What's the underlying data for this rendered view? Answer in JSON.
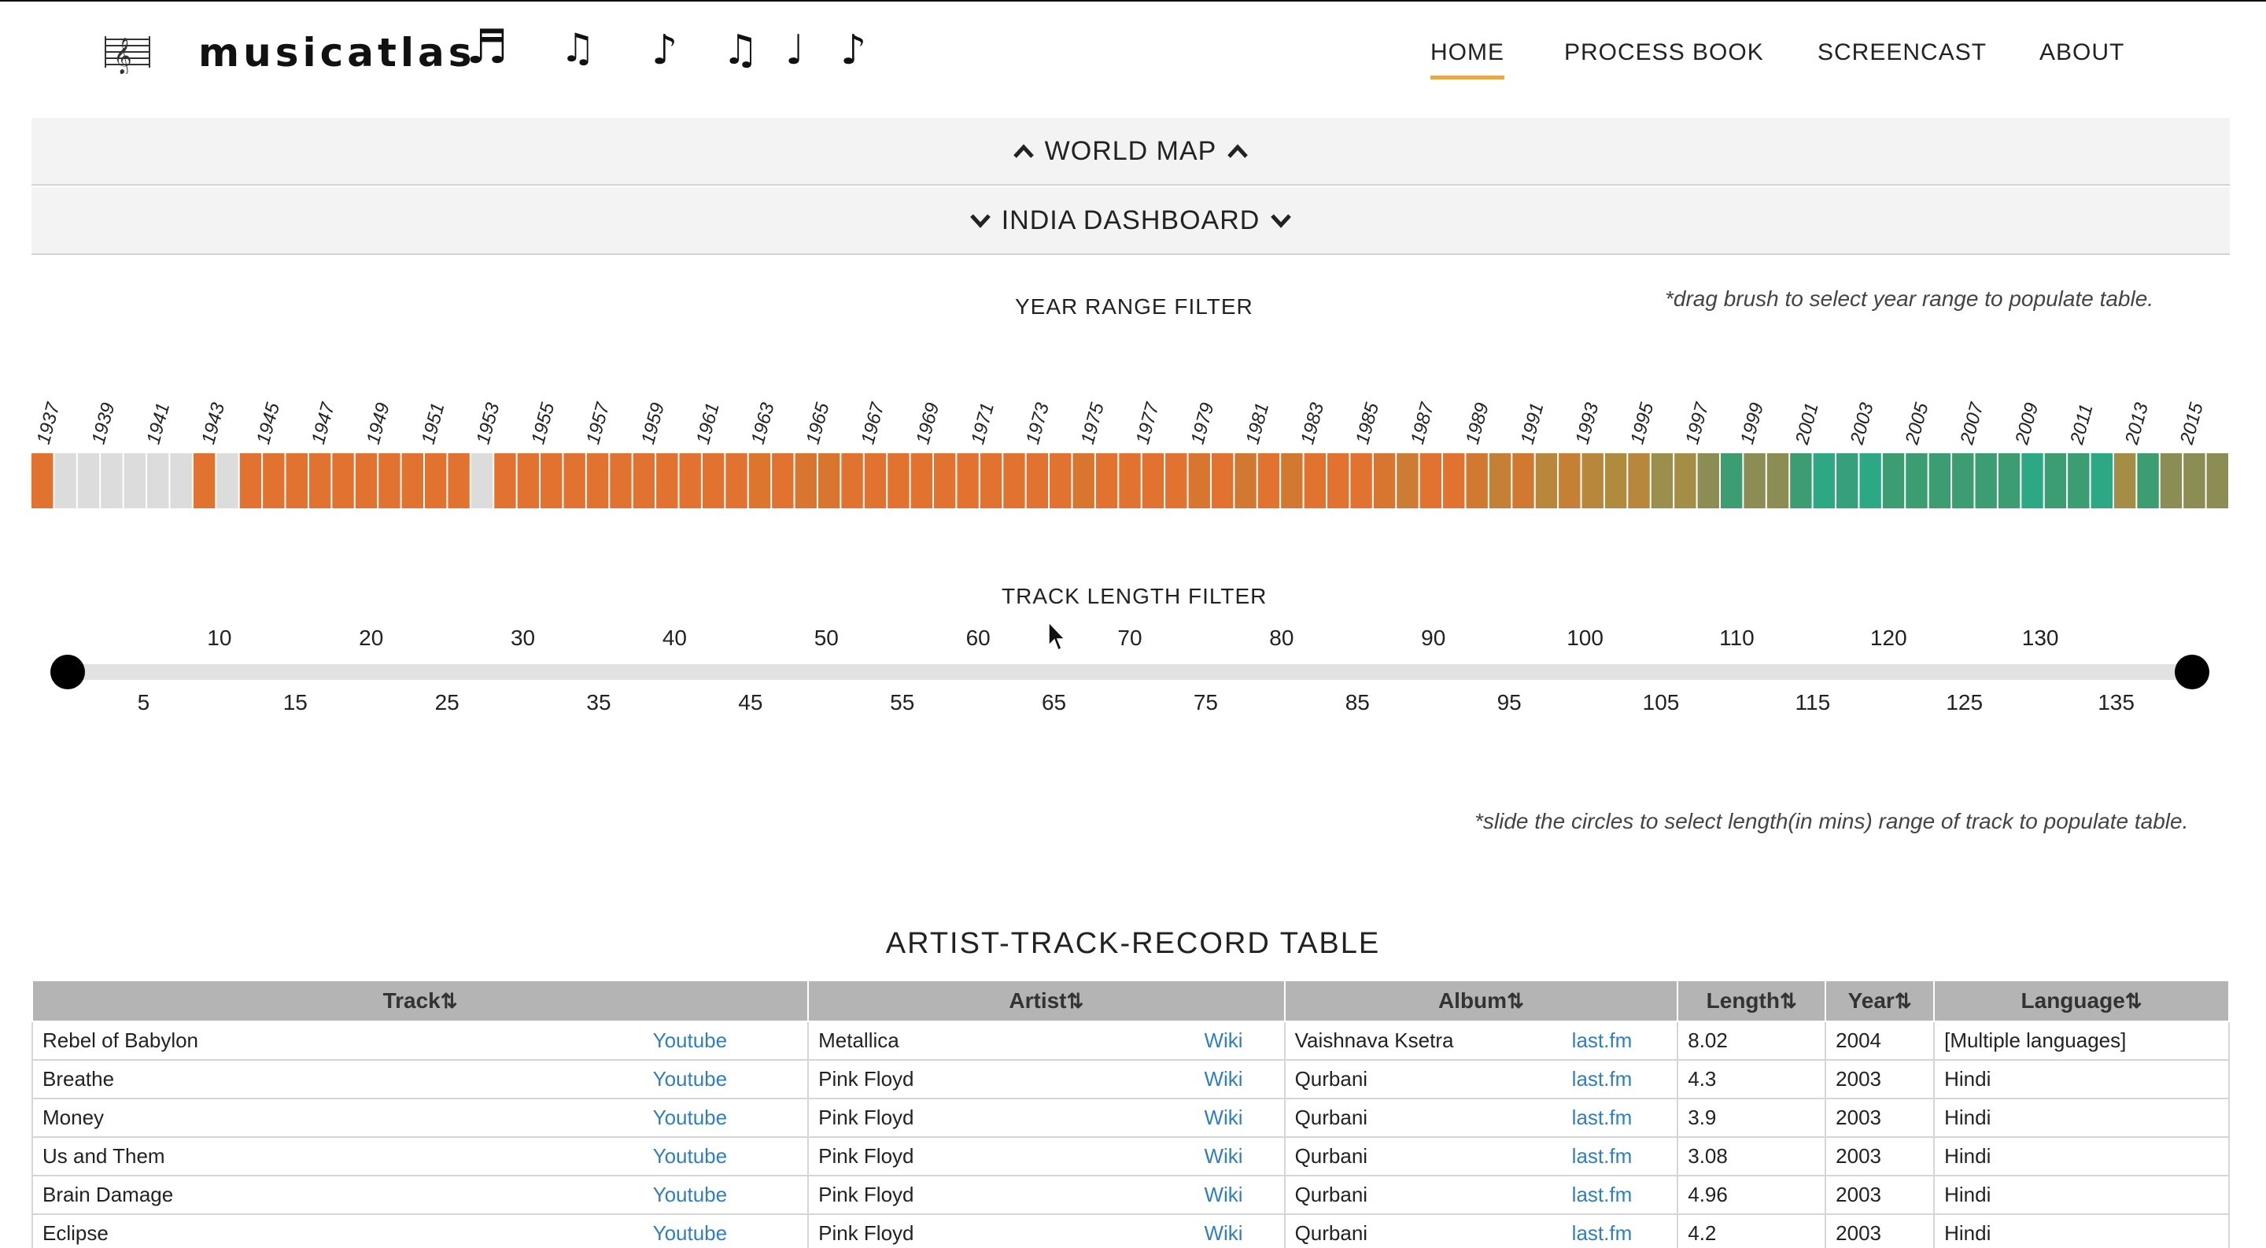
{
  "brand": {
    "name": "musicatlas"
  },
  "nav": [
    {
      "label": "HOME",
      "active": true
    },
    {
      "label": "PROCESS BOOK",
      "active": false
    },
    {
      "label": "SCREENCAST",
      "active": false
    },
    {
      "label": "ABOUT",
      "active": false
    }
  ],
  "panels": {
    "world_map": "WORLD MAP",
    "india_dashboard": "INDIA DASHBOARD"
  },
  "year_filter": {
    "title": "YEAR RANGE FILTER",
    "hint": "*drag brush to select year range to populate table.",
    "years_labeled": [
      "1937",
      "1939",
      "1941",
      "1943",
      "1945",
      "1947",
      "1949",
      "1951",
      "1953",
      "1955",
      "1957",
      "1959",
      "1961",
      "1963",
      "1965",
      "1967",
      "1969",
      "1971",
      "1973",
      "1975",
      "1977",
      "1979",
      "1981",
      "1983",
      "1985",
      "1987",
      "1989",
      "1991",
      "1993",
      "1995",
      "1997",
      "1999",
      "2001",
      "2003",
      "2005",
      "2007",
      "2009",
      "2011",
      "2013",
      "2015"
    ],
    "cell_colors": [
      "#e2722f",
      "#dcdcdc",
      "#dcdcdc",
      "#dcdcdc",
      "#dcdcdc",
      "#dcdcdc",
      "#dcdcdc",
      "#e2722f",
      "#dcdcdc",
      "#e2722f",
      "#e2722f",
      "#e2722f",
      "#e2722f",
      "#e2722f",
      "#e2722f",
      "#e2722f",
      "#e2722f",
      "#e2722f",
      "#e2722f",
      "#dcdcdc",
      "#e2722f",
      "#e2722f",
      "#e2722f",
      "#e2722f",
      "#e2722f",
      "#e2722f",
      "#e2722f",
      "#e2722f",
      "#e2722f",
      "#e2722f",
      "#e2722f",
      "#de752f",
      "#e2722f",
      "#d8762f",
      "#d8762f",
      "#e2722f",
      "#e2722f",
      "#e2722f",
      "#e2722f",
      "#e2722f",
      "#e2722f",
      "#e2722f",
      "#e2722f",
      "#e2722f",
      "#e2722f",
      "#d8762f",
      "#e2722f",
      "#e2722f",
      "#e2722f",
      "#e2722f",
      "#d8762f",
      "#e2722f",
      "#d27931",
      "#e2722f",
      "#d27931",
      "#e2722f",
      "#e2722f",
      "#e2722f",
      "#d8762f",
      "#cc7c33",
      "#e2722f",
      "#e2722f",
      "#d27931",
      "#c58036",
      "#d27931",
      "#b9873b",
      "#c58036",
      "#b9873b",
      "#b08b3e",
      "#b9873b",
      "#9a8f4c",
      "#a48d44",
      "#8c8c55",
      "#3d9d72",
      "#8c8c55",
      "#8c8c55",
      "#3d9d72",
      "#2da884",
      "#36a07c",
      "#2da884",
      "#3d9d72",
      "#3d9d72",
      "#3d9d72",
      "#3d9d72",
      "#3d9d72",
      "#3d9d72",
      "#2da884",
      "#3d9d72",
      "#3d9d72",
      "#2da884",
      "#a48d44",
      "#3d9d72",
      "#8c8c55",
      "#8c8c55",
      "#8c8c55"
    ]
  },
  "length_filter": {
    "title": "TRACK LENGTH FILTER",
    "hint": "*slide the circles to select length(in mins) range of track to populate table.",
    "top_ticks": [
      "10",
      "20",
      "30",
      "40",
      "50",
      "60",
      "70",
      "80",
      "90",
      "100",
      "110",
      "120",
      "130"
    ],
    "bottom_ticks": [
      "5",
      "15",
      "25",
      "35",
      "45",
      "55",
      "65",
      "75",
      "85",
      "95",
      "105",
      "115",
      "125",
      "135"
    ],
    "range_min": 0,
    "range_max": 140,
    "selected_low": 0,
    "selected_high": 140
  },
  "table": {
    "title": "ARTIST-TRACK-RECORD TABLE",
    "headers": [
      "Track",
      "Artist",
      "Album",
      "Length",
      "Year",
      "Language"
    ],
    "sort_icon": "⇅",
    "rows": [
      {
        "track": "Rebel of Babylon",
        "track_link": "Youtube",
        "artist": "Metallica",
        "artist_link": "Wiki",
        "album": "Vaishnava Ksetra",
        "album_link": "last.fm",
        "length": "8.02",
        "year": "2004",
        "language": "[Multiple languages]"
      },
      {
        "track": "Breathe",
        "track_link": "Youtube",
        "artist": "Pink Floyd",
        "artist_link": "Wiki",
        "album": "Qurbani",
        "album_link": "last.fm",
        "length": "4.3",
        "year": "2003",
        "language": "Hindi"
      },
      {
        "track": "Money",
        "track_link": "Youtube",
        "artist": "Pink Floyd",
        "artist_link": "Wiki",
        "album": "Qurbani",
        "album_link": "last.fm",
        "length": "3.9",
        "year": "2003",
        "language": "Hindi"
      },
      {
        "track": "Us and Them",
        "track_link": "Youtube",
        "artist": "Pink Floyd",
        "artist_link": "Wiki",
        "album": "Qurbani",
        "album_link": "last.fm",
        "length": "3.08",
        "year": "2003",
        "language": "Hindi"
      },
      {
        "track": "Brain Damage",
        "track_link": "Youtube",
        "artist": "Pink Floyd",
        "artist_link": "Wiki",
        "album": "Qurbani",
        "album_link": "last.fm",
        "length": "4.96",
        "year": "2003",
        "language": "Hindi"
      },
      {
        "track": "Eclipse",
        "track_link": "Youtube",
        "artist": "Pink Floyd",
        "artist_link": "Wiki",
        "album": "Qurbani",
        "album_link": "last.fm",
        "length": "4.2",
        "year": "2003",
        "language": "Hindi"
      }
    ]
  },
  "colors": {
    "accent_underline": "#e8a94a",
    "link": "#2f7fc0",
    "empty_year": "#dcdcdc"
  },
  "icons": {
    "logo": "music-score-icon",
    "notes": [
      "beamed-sixteenth-notes-icon",
      "beamed-eighth-notes-icon",
      "eighth-note-icon",
      "beamed-eighth-notes-icon",
      "quarter-note-icon",
      "eighth-note-icon"
    ],
    "panel_up": "chevron-up-icon",
    "panel_down": "chevron-down-icon"
  }
}
